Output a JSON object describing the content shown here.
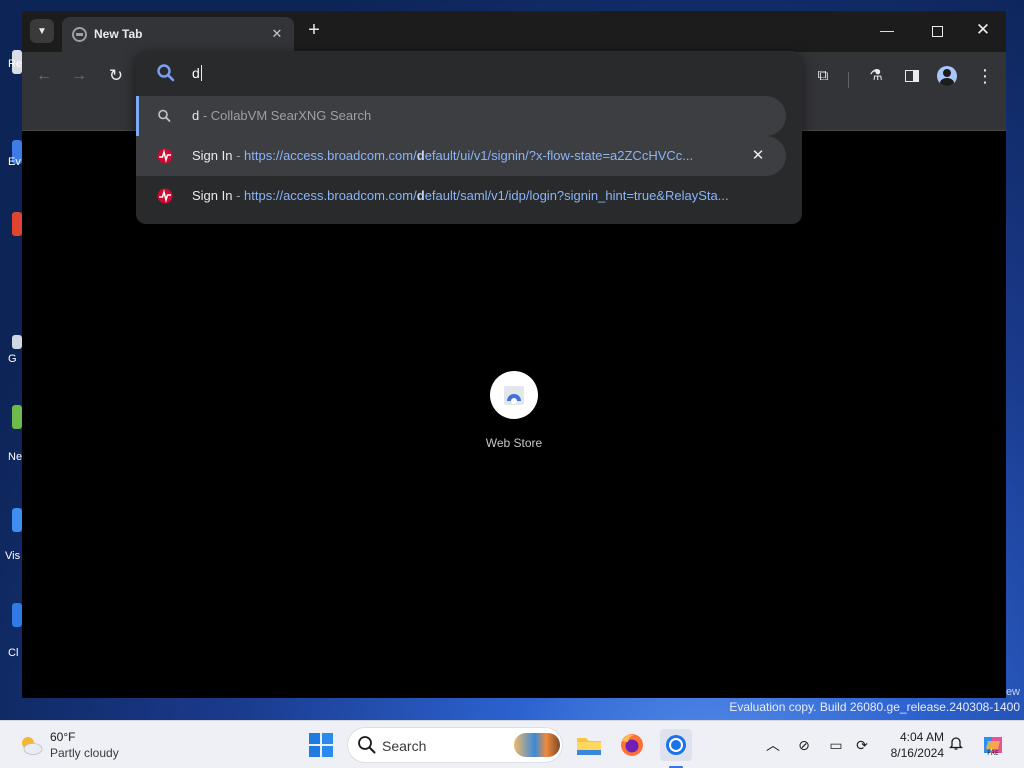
{
  "desktop": {
    "icons": [
      {
        "label": "Re",
        "color": "#ffffff"
      },
      {
        "label": "Ev",
        "color": "#3e7be6"
      },
      {
        "label": "",
        "color": "#e0462f"
      },
      {
        "label": "G",
        "color": "#ffffff"
      },
      {
        "label": "Ne",
        "color": "#6dbb4b"
      },
      {
        "label": "Vis",
        "color": "#3d8ef0"
      },
      {
        "label": "Cl",
        "color": "#2f7ae5"
      }
    ],
    "watermark_prev": "ew",
    "watermark": "Evaluation copy. Build 26080.ge_release.240308-1400"
  },
  "browser": {
    "tab": {
      "title": "New Tab",
      "close": "✕"
    },
    "new_tab_button": "+",
    "window_controls": {
      "minimize": "—",
      "close": "✕"
    },
    "toolbar": {
      "back": "←",
      "forward": "→",
      "reload": "↻",
      "extensions": "⧉",
      "labs": "⚗",
      "menu": "⋮"
    },
    "omnibox": {
      "input": "d",
      "suggestions": [
        {
          "type": "search",
          "main": "d",
          "sep": " - ",
          "desc": "CollabVM SearXNG Search",
          "url_pre": "",
          "url_bold": "",
          "url_post": "",
          "icon": "search-icon"
        },
        {
          "type": "history",
          "main": "Sign In",
          "sep": " - ",
          "desc": "",
          "url_pre": "https://access.broadcom.com/",
          "url_bold": "d",
          "url_post": "efault/ui/v1/signin/?x-flow-state=a2ZCcHVCc...",
          "icon": "broadcom-favicon",
          "remove": "✕"
        },
        {
          "type": "history",
          "main": "Sign In",
          "sep": " - ",
          "desc": "",
          "url_pre": "https://access.broadcom.com/",
          "url_bold": "d",
          "url_post": "efault/saml/v1/idp/login?signin_hint=true&RelaySta...",
          "icon": "broadcom-favicon"
        }
      ]
    },
    "shortcut": {
      "label": "Web Store"
    }
  },
  "taskbar": {
    "weather": {
      "temp": "60°F",
      "condition": "Partly cloudy"
    },
    "search_label": "Search",
    "tray": {
      "chevron": "︿",
      "network": "⊘",
      "display": "▭",
      "sync": "⟳",
      "bell": "🔔"
    },
    "clock": {
      "time": "4:04 AM",
      "date": "8/16/2024"
    }
  },
  "colors": {
    "accent": "#8ab4f8",
    "brand_red": "#cc092f",
    "chrome_blue": "#1a73e8"
  }
}
